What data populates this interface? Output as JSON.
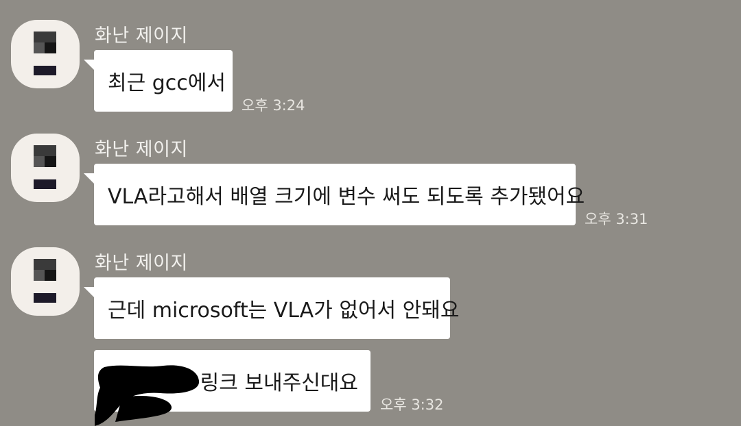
{
  "messages": [
    {
      "sender": "화난 제이지",
      "texts": [
        "최근 gcc에서"
      ],
      "time": "오후 3:24"
    },
    {
      "sender": "화난 제이지",
      "texts": [
        "VLA라고해서 배열 크기에 변수 써도 되도록 추가됐어요"
      ],
      "time": "오후 3:31"
    },
    {
      "sender": "화난 제이지",
      "texts": [
        "근데 microsoft는 VLA가 없어서 안돼요",
        "링크 보내주신대요"
      ],
      "time": "오후 3:32"
    }
  ],
  "colors": {
    "background": "#8f8c86",
    "bubble": "#ffffff",
    "avatar_bg": "#f3efea"
  }
}
